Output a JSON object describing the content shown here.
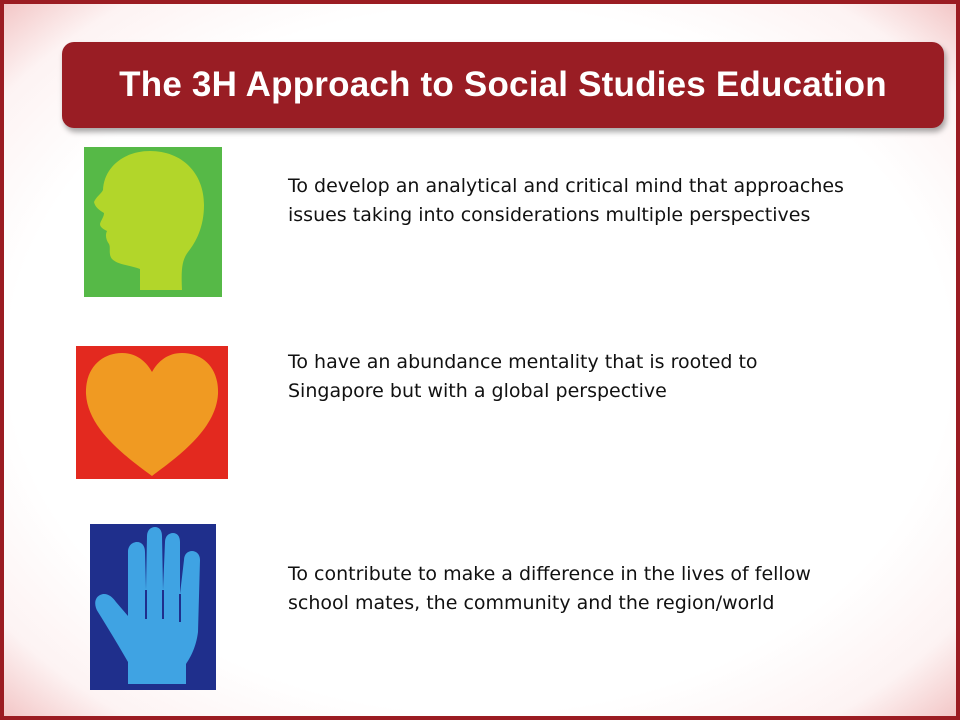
{
  "title": "The 3H Approach to Social Studies Education",
  "items": [
    {
      "icon": "head-icon",
      "icon_color": "#b2d62a",
      "background_color": "#56b947",
      "text": "To develop an analytical and critical mind that approaches issues taking into considerations multiple perspectives"
    },
    {
      "icon": "heart-icon",
      "icon_color": "#f09a22",
      "background_color": "#e3291f",
      "text": "To have an abundance mentality that is rooted to Singapore but with a global perspective"
    },
    {
      "icon": "hand-icon",
      "icon_color": "#3fa3e3",
      "background_color": "#1f2f8c",
      "text": "To contribute to make a difference in the lives of fellow school mates, the community and the region/world"
    }
  ],
  "colors": {
    "title_background": "#991d24",
    "title_text": "#ffffff",
    "slide_border": "#9b1c22"
  }
}
